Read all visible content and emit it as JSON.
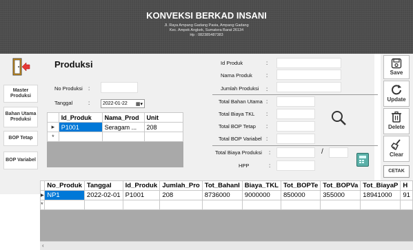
{
  "header": {
    "title": "KONVEKSI BERKAD INSANI",
    "address_line1": "Jl. Raya Ampang Gadang Pasia, Ampang Gadang",
    "address_line2": "Kec. Ampek Angkek, Sumatera Barat 26134",
    "phone": "Hp : 082385487383"
  },
  "sidebar": {
    "items": [
      {
        "label": "Master Produksi"
      },
      {
        "label": "Bahan Utama Produksi"
      },
      {
        "label": "BOP Tetap"
      },
      {
        "label": "BOP Variabel"
      }
    ]
  },
  "form": {
    "title": "Produksi",
    "no_produksi_label": "No Produksi",
    "no_produksi_value": "",
    "tanggal_label": "Tanggal",
    "tanggal_value": "2022-01-22",
    "id_produk_label": "Id Produk",
    "nama_produk_label": "Nama Produk",
    "jumlah_produksi_label": "Jumlah Produksi",
    "total_bahan_utama_label": "Total Bahan Utama",
    "total_biaya_tkl_label": "Total Biaya TKL",
    "total_bop_tetap_label": "Total BOP Tetap",
    "total_bop_variabel_label": "Total BOP Variabel",
    "total_biaya_produksi_label": "Total Biaya Produksi",
    "hpp_label": "HPP",
    "slash": "/"
  },
  "product_grid": {
    "columns": [
      "Id_Produk",
      "Nama_Prod",
      "Unit"
    ],
    "rows": [
      [
        "P1001",
        "Seragam ...",
        "208"
      ]
    ]
  },
  "buttons": {
    "save": "Save",
    "update": "Update",
    "delete": "Delete",
    "clear": "Clear",
    "cetak": "CETAK"
  },
  "production_grid": {
    "columns": [
      "No_Produk",
      "Tanggal",
      "Id_Produk",
      "Jumlah_Pro",
      "Tot_BahanI",
      "Biaya_TKL",
      "Tot_BOPTe",
      "Tot_BOPVa",
      "Tot_BiayaP",
      "H"
    ],
    "rows": [
      [
        "NP1",
        "2022-02-01",
        "P1001",
        "208",
        "8736000",
        "9000000",
        "850000",
        "355000",
        "18941000",
        "91"
      ]
    ]
  },
  "colors": {
    "header_bg": "#4a4a4a",
    "selection": "#0078d7"
  }
}
